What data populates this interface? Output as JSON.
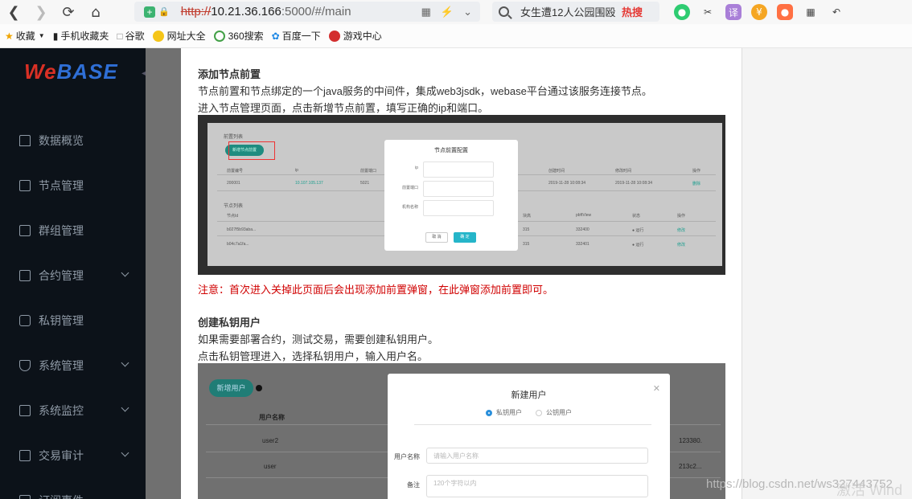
{
  "browser": {
    "url_scheme": "http://",
    "url_host": "10.21.36.166",
    "url_rest": ":5000/#/main",
    "search_text": "女生遭12人公园围殴",
    "search_hot": "热搜",
    "translate_label": "译"
  },
  "bookmarks": [
    {
      "label": "收藏",
      "color": "#f0a500"
    },
    {
      "label": "手机收藏夹",
      "color": "#333333"
    },
    {
      "label": "谷歌",
      "color": "#ffffff"
    },
    {
      "label": "网址大全",
      "color": "#2e7d32"
    },
    {
      "label": "360搜索",
      "color": "#43a047"
    },
    {
      "label": "百度一下",
      "color": "#1e88e5"
    },
    {
      "label": "游戏中心",
      "color": "#d32f2f"
    }
  ],
  "sidebar": {
    "logo_we": "We",
    "logo_base": "BASE",
    "items": [
      {
        "label": "数据概览",
        "icon": "home-icon",
        "has_chevron": false
      },
      {
        "label": "节点管理",
        "icon": "calendar-icon",
        "has_chevron": false
      },
      {
        "label": "群组管理",
        "icon": "calendar-icon",
        "has_chevron": false
      },
      {
        "label": "合约管理",
        "icon": "document-icon",
        "has_chevron": true
      },
      {
        "label": "私钥管理",
        "icon": "lock-icon",
        "has_chevron": false
      },
      {
        "label": "系统管理",
        "icon": "shield-icon",
        "has_chevron": true
      },
      {
        "label": "系统监控",
        "icon": "monitor-icon",
        "has_chevron": true
      },
      {
        "label": "交易审计",
        "icon": "calendar-icon",
        "has_chevron": true
      },
      {
        "label": "订阅事件",
        "icon": "bell-icon",
        "has_chevron": false
      }
    ]
  },
  "doc": {
    "section1_title": "添加节点前置",
    "section1_p1": "节点前置和节点绑定的一个java服务的中间件，集成web3jsdk，webase平台通过该服务连接节点。",
    "section1_p2": "进入节点管理页面，点击新增节点前置，填写正确的ip和端口。",
    "warning": "注意：首次进入关掉此页面后会出现添加前置弹窗，在此弹窗添加前置即可。",
    "section2_title": "创建私钥用户",
    "section2_p1": "如果需要部署合约，测试交易，需要创建私钥用户。",
    "section2_p2": "点击私钥管理进入，选择私钥用户，输入用户名。"
  },
  "shot1": {
    "list_title": "前置列表",
    "add_button": "新增节点前置",
    "col_headers": [
      "前置编号",
      "ip",
      "前置端口",
      "",
      "创建时间",
      "修改时间",
      "操作"
    ],
    "row1": [
      "200001",
      "10.107.105.137",
      "5021",
      "",
      "2019-11-28 10:08:34",
      "2019-11-28 10:08:34",
      "删除"
    ],
    "node_list_title": "节点列表",
    "node_headers": [
      "节点Id",
      "",
      "块高",
      "pbftView",
      "状态",
      "操作"
    ],
    "node_rows": [
      [
        "b027f5b93aba...",
        "",
        "315",
        "332400",
        "● 运行",
        "修改"
      ],
      [
        "b04c7a1fa...",
        "",
        "315",
        "332401",
        "● 运行",
        "修改"
      ]
    ],
    "modal_title": "节点前置配置",
    "modal_labels": [
      "ip",
      "前置端口",
      "机构名称"
    ],
    "cancel_label": "取 消",
    "ok_label": "确 定"
  },
  "shot2": {
    "add_button": "新增用户",
    "col_header_user": "用户名称",
    "users": [
      "user2",
      "user"
    ],
    "address_fragments": [
      "123380.",
      "213c2..."
    ],
    "modal_title": "新建用户",
    "radio_private": "私钥用户",
    "radio_public": "公钥用户",
    "label_username": "用户名称",
    "label_note": "备注",
    "placeholder_username": "请输入用户名称",
    "placeholder_note": "120个字符以内"
  },
  "watermark": "https://blog.csdn.net/ws327443752",
  "watermark_win": "激活 Wind"
}
